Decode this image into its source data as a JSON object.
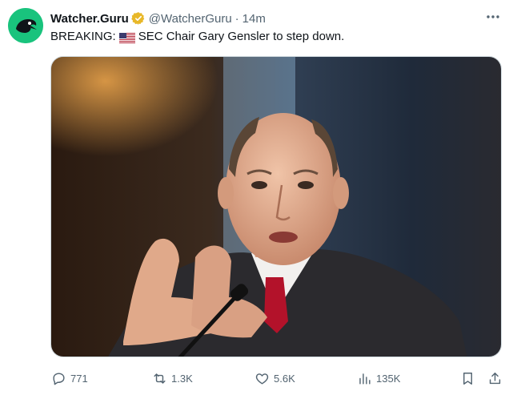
{
  "tweet": {
    "author_name": "Watcher.Guru",
    "handle": "@WatcherGuru",
    "separator": "·",
    "time": "14m",
    "text_prefix": "BREAKING:",
    "text_body": "SEC Chair Gary Gensler to step down."
  },
  "icons": {
    "avatar": "watcher-guru-logo",
    "verified": "verified-badge-icon",
    "flag": "us-flag-emoji",
    "more": "more-options-icon",
    "reply": "reply-icon",
    "repost": "repost-icon",
    "like": "like-icon",
    "views": "views-icon",
    "bookmark": "bookmark-icon",
    "share": "share-icon"
  },
  "actions": {
    "replies": "771",
    "reposts": "1.3K",
    "likes": "5.6K",
    "views": "135K"
  },
  "colors": {
    "avatar_bg": "#19c37d",
    "verified_badge": "#e8b829",
    "secondary_text": "#536471"
  }
}
